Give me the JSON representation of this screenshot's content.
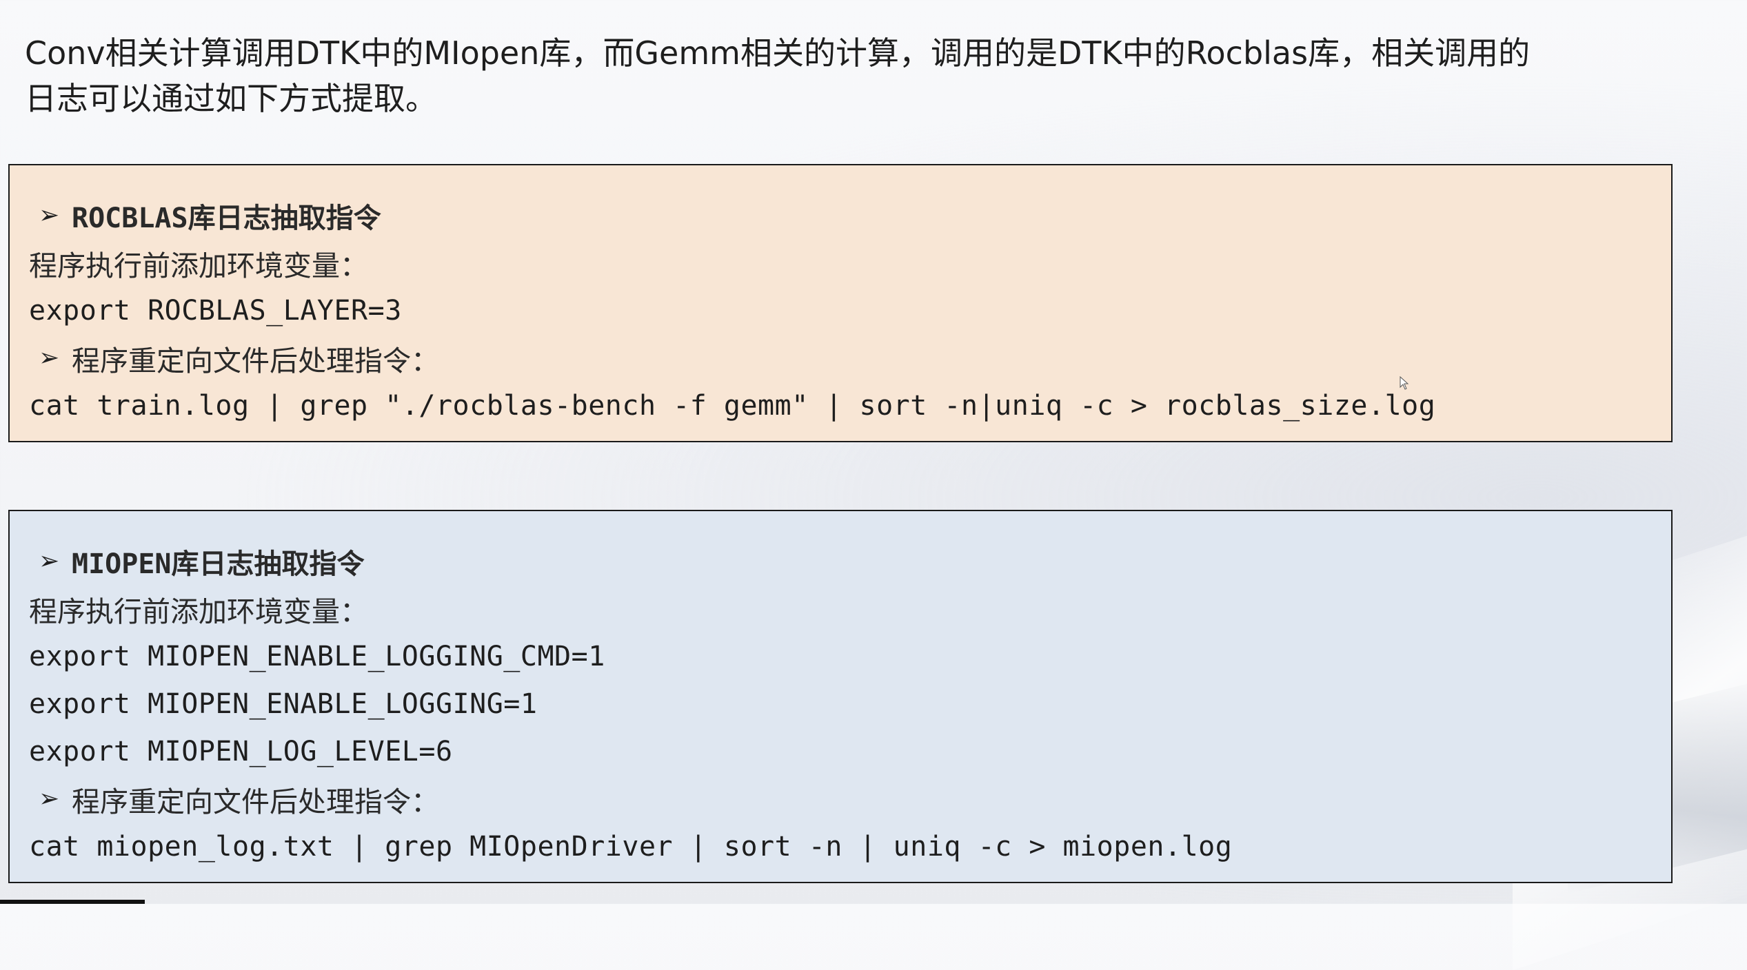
{
  "intro": {
    "line1": "Conv相关计算调用DTK中的MIopen库，而Gemm相关的计算，调用的是DTK中的Rocblas库，相关调用的",
    "line2": "日志可以通过如下方式提取。"
  },
  "rocblas_box": {
    "arrow": "➢",
    "heading": "ROCBLAS库日志抽取指令",
    "env_label": "程序执行前添加环境变量：",
    "env_cmds": [
      "export ROCBLAS_LAYER=3"
    ],
    "post_label": "程序重定向文件后处理指令：",
    "post_cmd": "cat train.log | grep \"./rocblas-bench -f gemm\" | sort -n|uniq -c > rocblas_size.log"
  },
  "miopen_box": {
    "arrow": "➢",
    "heading": "MIOPEN库日志抽取指令",
    "env_label": "程序执行前添加环境变量：",
    "env_cmds": [
      "export MIOPEN_ENABLE_LOGGING_CMD=1",
      "export MIOPEN_ENABLE_LOGGING=1",
      "export MIOPEN_LOG_LEVEL=6"
    ],
    "post_label": "程序重定向文件后处理指令：",
    "post_cmd": "cat miopen_log.txt | grep MIOpenDriver | sort -n | uniq -c > miopen.log"
  },
  "colors": {
    "rocblas_bg": "#f8e6d5",
    "miopen_bg": "#dfe7f1",
    "border": "#1a1a1a"
  }
}
